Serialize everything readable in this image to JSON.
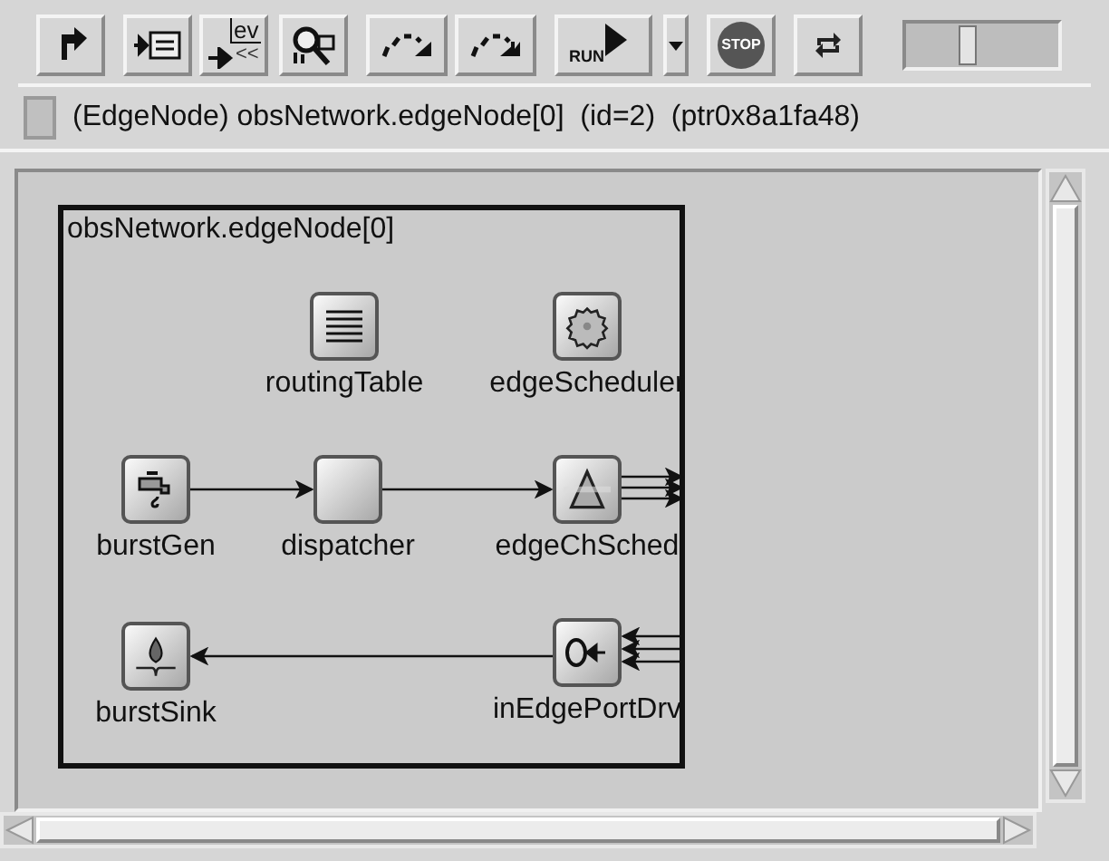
{
  "toolbar": [
    {
      "kind": "up"
    },
    {
      "kind": "log"
    },
    {
      "kind": "events",
      "label": "ev",
      "sublabel": "<<"
    },
    {
      "kind": "inspect"
    },
    {
      "kind": "step"
    },
    {
      "kind": "stepfast"
    },
    {
      "kind": "run",
      "label": "RUN"
    },
    {
      "kind": "dropdown"
    },
    {
      "kind": "stop",
      "label": "STOP"
    },
    {
      "kind": "refresh"
    },
    {
      "kind": "slider",
      "level": 0.4
    }
  ],
  "info_bar": {
    "text": "(EdgeNode) obsNetwork.edgeNode[0]  (id=2)  (ptr0x8a1fa48)"
  },
  "canvas": {
    "module_title": "obsNetwork.edgeNode[0]",
    "nodes": [
      {
        "name": "routingTable",
        "kind": "table"
      },
      {
        "name": "edgeScheduler",
        "kind": "gear"
      },
      {
        "name": "burstGen",
        "kind": "source"
      },
      {
        "name": "dispatcher",
        "kind": "plain"
      },
      {
        "name": "edgeChSched",
        "kind": "prism"
      },
      {
        "name": "burstSink",
        "kind": "sink"
      },
      {
        "name": "inEdgePortDrv",
        "kind": "port"
      }
    ]
  }
}
